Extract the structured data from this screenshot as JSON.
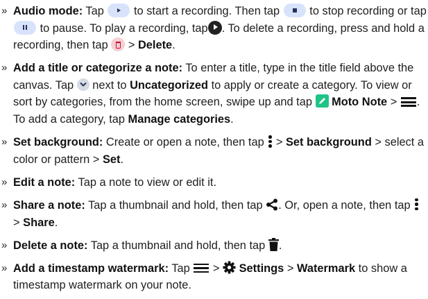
{
  "bullet": "»",
  "items": [
    {
      "title": "Audio mode:",
      "t1": "Tap",
      "t2": "to start a recording. Then tap",
      "t3": "to stop recording or tap",
      "t4": "to pause. To play a recording, tap",
      "t5": ". To delete a recording, press and hold a recording, then tap",
      "t6": ">",
      "b1": "Delete",
      "t7": "."
    },
    {
      "title": "Add a title or categorize a note:",
      "t1": "To enter a title, type in the title field above the canvas. Tap",
      "t2": "next to",
      "b1": "Uncategorized",
      "t3": "to apply or create a category. To view or sort by categories, from the home screen, swipe up and tap",
      "b2": "Moto Note",
      "t4": ">",
      "t5": ". To add a category, tap",
      "b3": "Manage categories",
      "t6": "."
    },
    {
      "title": "Set background:",
      "t1": "Create or open a note, then tap",
      "t2": ">",
      "b1": "Set background",
      "t3": "> select a color or pattern >",
      "b2": "Set",
      "t4": "."
    },
    {
      "title": "Edit a note:",
      "t1": "Tap a note to view or edit it."
    },
    {
      "title": "Share a note:",
      "t1": "Tap a thumbnail and hold, then tap",
      "t2": ". Or, open a note, then tap",
      "t3": ">",
      "b1": "Share",
      "t4": "."
    },
    {
      "title": "Delete a note:",
      "t1": "Tap a thumbnail and hold, then tap",
      "t2": "."
    },
    {
      "title": "Add a timestamp watermark:",
      "t1": "Tap",
      "t2": ">",
      "b1": "Settings",
      "t3": ">",
      "b2": "Watermark",
      "t4": "to show a timestamp watermark on your note."
    }
  ],
  "colors": {
    "pill_bg": "#d8e3fb",
    "moto_green": "#20c486",
    "delete_pink": "#f6cfd4",
    "delete_red": "#c8102e"
  }
}
